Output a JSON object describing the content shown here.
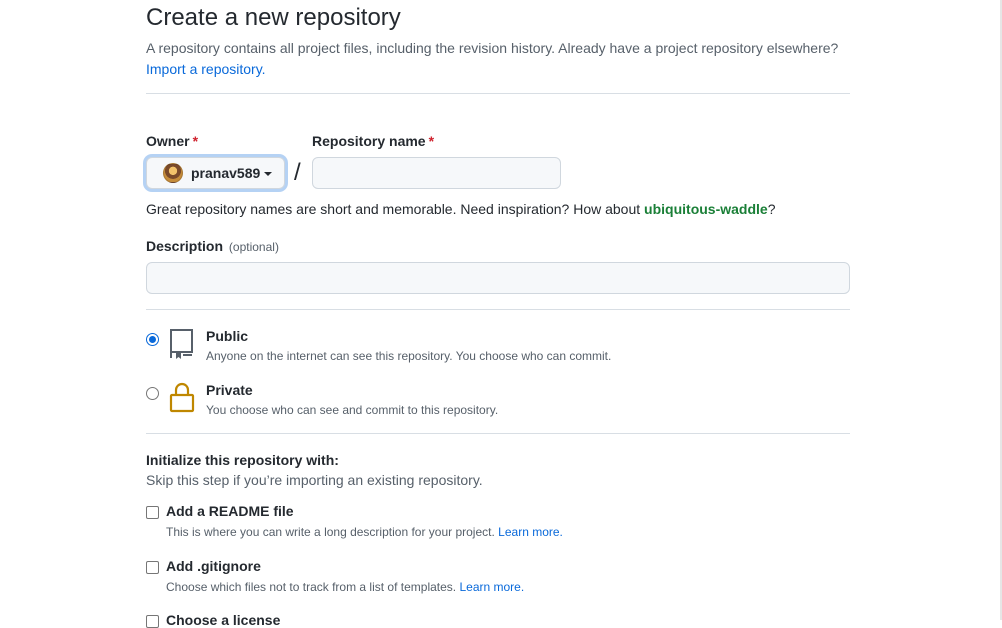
{
  "header": {
    "title": "Create a new repository",
    "subtitle": "A repository contains all project files, including the revision history. Already have a project repository elsewhere?",
    "import_link": "Import a repository."
  },
  "owner": {
    "label": "Owner",
    "required_mark": "*",
    "value": "pranav589"
  },
  "repo_name": {
    "label": "Repository name",
    "required_mark": "*",
    "value": "",
    "separator": "/"
  },
  "hint": {
    "prefix": "Great repository names are short and memorable. Need inspiration? How about ",
    "suggestion": "ubiquitous-waddle",
    "suffix": "?"
  },
  "description": {
    "label": "Description",
    "optional": "(optional)",
    "value": ""
  },
  "visibility": {
    "selected": "public",
    "options": [
      {
        "id": "public",
        "title": "Public",
        "desc": "Anyone on the internet can see this repository. You choose who can commit.",
        "icon": "repo-icon",
        "icon_color": "#57606a"
      },
      {
        "id": "private",
        "title": "Private",
        "desc": "You choose who can see and commit to this repository.",
        "icon": "lock-icon",
        "icon_color": "#bf8700"
      }
    ]
  },
  "init": {
    "title": "Initialize this repository with:",
    "subtitle": "Skip this step if you’re importing an existing repository.",
    "options": [
      {
        "title": "Add a README file",
        "desc": "This is where you can write a long description for your project.",
        "link": "Learn more."
      },
      {
        "title": "Add .gitignore",
        "desc": "Choose which files not to track from a list of templates.",
        "link": "Learn more."
      },
      {
        "title": "Choose a license",
        "desc": "",
        "link": ""
      }
    ]
  },
  "colors": {
    "accent": "#0969da",
    "suggestion": "#1a7f37",
    "required": "#cf222e"
  }
}
